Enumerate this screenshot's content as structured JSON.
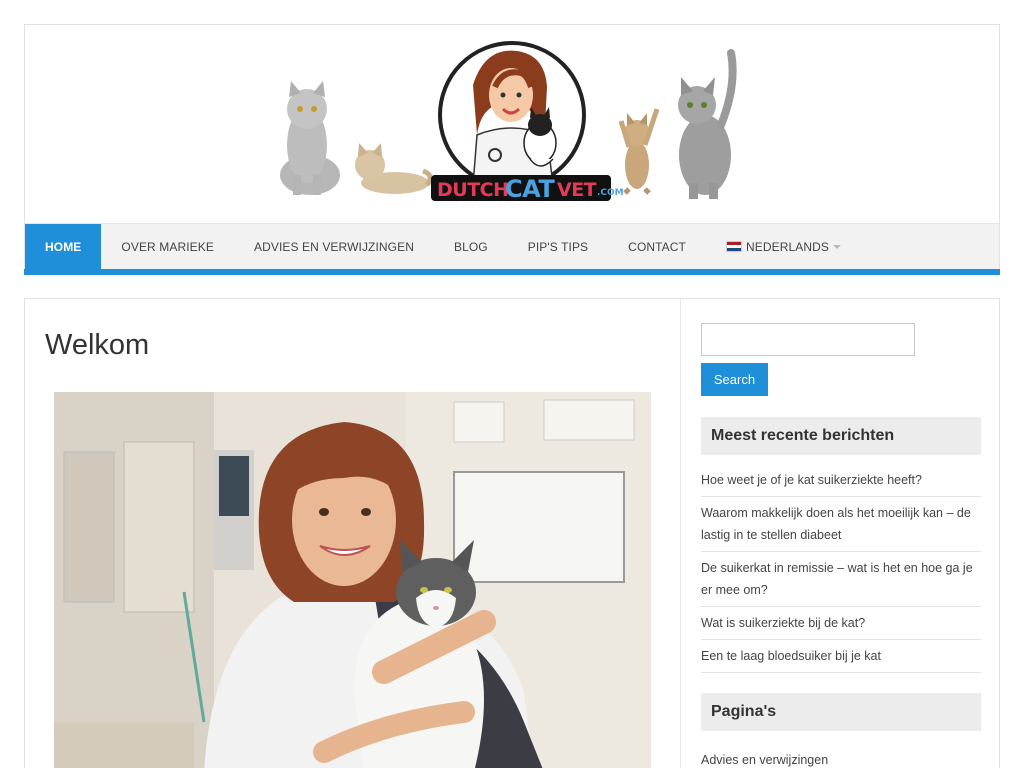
{
  "header": {
    "logo_text": "DUTCHCATVET.COM"
  },
  "nav": {
    "items": [
      {
        "label": "HOME"
      },
      {
        "label": "OVER MARIEKE"
      },
      {
        "label": "ADVIES EN VERWIJZINGEN"
      },
      {
        "label": "BLOG"
      },
      {
        "label": "PIP'S TIPS"
      },
      {
        "label": "CONTACT"
      },
      {
        "label": "NEDERLANDS"
      }
    ]
  },
  "main": {
    "title": "Welkom"
  },
  "sidebar": {
    "search": {
      "value": "",
      "button_label": "Search"
    },
    "recent_posts": {
      "title": "Meest recente berichten",
      "items": [
        "Hoe weet je of je kat suikerziekte heeft?",
        "Waarom makkelijk doen als het moeilijk kan – de lastig in te stellen diabeet",
        "De suikerkat in remissie – wat is het en hoe ga je er mee om?",
        "Wat is suikerziekte bij de kat?",
        "Een te laag bloedsuiker bij je kat"
      ]
    },
    "pages": {
      "title": "Pagina's",
      "items": [
        "Advies en verwijzingen"
      ]
    }
  },
  "colors": {
    "accent": "#1e8fd8",
    "nav_bg": "#f2f2f2",
    "widget_title_bg": "#ececec"
  }
}
